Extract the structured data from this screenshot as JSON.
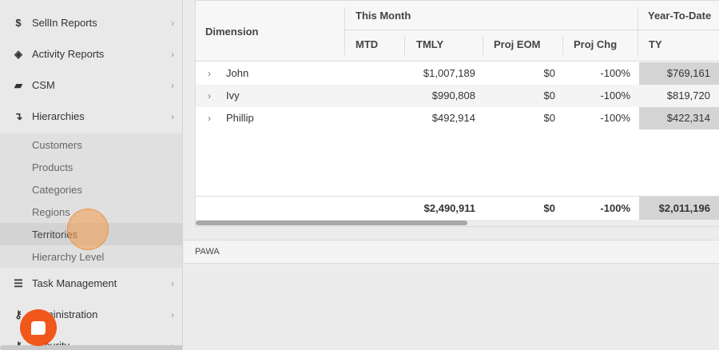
{
  "sidebar": {
    "items": [
      {
        "icon": "dollar-icon",
        "glyph": "$",
        "label": "SellIn Reports"
      },
      {
        "icon": "cube-icon",
        "glyph": "◈",
        "label": "Activity Reports"
      },
      {
        "icon": "book-icon",
        "glyph": "▰",
        "label": "CSM"
      },
      {
        "icon": "hierarchy-icon",
        "glyph": "↴",
        "label": "Hierarchies"
      },
      {
        "icon": "tasks-icon",
        "glyph": "☰",
        "label": "Task Management"
      },
      {
        "icon": "key-icon",
        "glyph": "⚷",
        "label": "Administration"
      },
      {
        "icon": "security-icon",
        "glyph": "⚷",
        "label": "Security"
      }
    ],
    "chevron": "›",
    "hierarchies_sub": [
      "Customers",
      "Products",
      "Categories",
      "Regions",
      "Territories",
      "Hierarchy Level"
    ],
    "active_sub": "Territories"
  },
  "grid": {
    "header": {
      "dimension": "Dimension",
      "group_this_month": "This Month",
      "group_ytd": "Year-To-Date",
      "cols": [
        "MTD",
        "TMLY",
        "Proj EOM",
        "Proj Chg",
        "TY"
      ]
    },
    "rows": [
      {
        "name": "John",
        "tmly": "$1,007,189",
        "proj_eom": "$0",
        "proj_chg": "-100%",
        "ty": "$769,161"
      },
      {
        "name": "Ivy",
        "tmly": "$990,808",
        "proj_eom": "$0",
        "proj_chg": "-100%",
        "ty": "$819,720"
      },
      {
        "name": "Phillip",
        "tmly": "$492,914",
        "proj_eom": "$0",
        "proj_chg": "-100%",
        "ty": "$422,314"
      }
    ],
    "totals": {
      "tmly": "$2,490,911",
      "proj_eom": "$0",
      "proj_chg": "-100%",
      "ty": "$2,011,196"
    },
    "expand_glyph": "›"
  },
  "footer": {
    "text": "PAWA"
  },
  "colors": {
    "negative": "#d01a1a",
    "chat": "#f1561a",
    "highlight": "#d4d4d4"
  }
}
